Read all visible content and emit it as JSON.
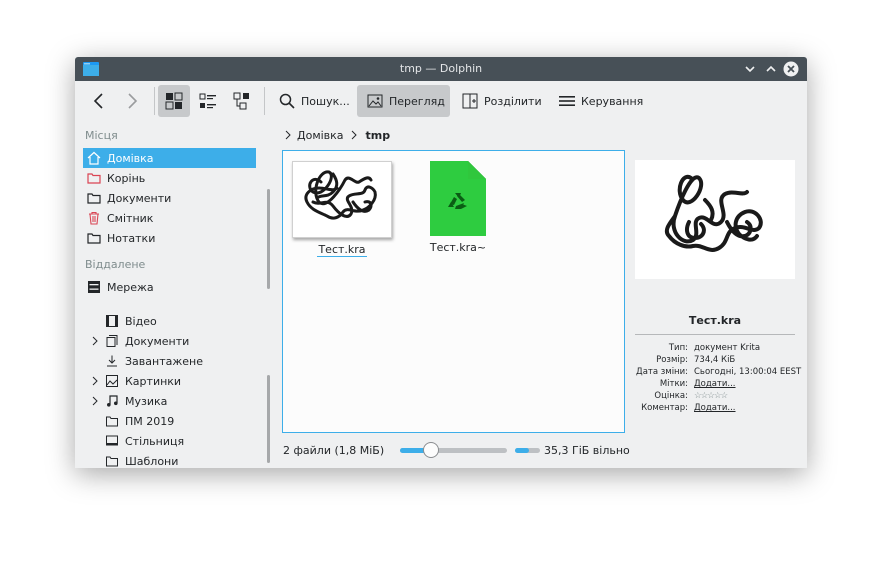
{
  "window": {
    "title": "tmp — Dolphin"
  },
  "toolbar": {
    "search_label": "Пошук...",
    "preview_label": "Перегляд",
    "split_label": "Розділити",
    "control_label": "Керування"
  },
  "sidebar": {
    "places_title": "Місця",
    "places": [
      {
        "label": "Домівка",
        "icon": "home-icon",
        "selected": true
      },
      {
        "label": "Корінь",
        "icon": "folder-red-icon"
      },
      {
        "label": "Документи",
        "icon": "folder-icon"
      },
      {
        "label": "Смітник",
        "icon": "trash-icon"
      },
      {
        "label": "Нотатки",
        "icon": "folder-icon"
      }
    ],
    "remote_title": "Віддалене",
    "remote": [
      {
        "label": "Мережа",
        "icon": "network-icon"
      }
    ],
    "tree": [
      {
        "label": "Відео",
        "icon": "video-icon",
        "expandable": false
      },
      {
        "label": "Документи",
        "icon": "documents-icon",
        "expandable": true
      },
      {
        "label": "Завантажене",
        "icon": "download-icon",
        "expandable": false
      },
      {
        "label": "Картинки",
        "icon": "pictures-icon",
        "expandable": true
      },
      {
        "label": "Музика",
        "icon": "music-icon",
        "expandable": true
      },
      {
        "label": "ПМ 2019",
        "icon": "folder-icon",
        "expandable": false
      },
      {
        "label": "Стільниця",
        "icon": "desktop-icon",
        "expandable": false
      },
      {
        "label": "Шаблони",
        "icon": "folder-icon",
        "expandable": false
      }
    ]
  },
  "breadcrumb": {
    "home": "Домівка",
    "current": "tmp"
  },
  "files": [
    {
      "name": "Тест.kra",
      "type": "kra-thumbnail"
    },
    {
      "name": "Тест.kra~",
      "type": "backup-file-icon"
    }
  ],
  "status": {
    "file_count": "2 файли (1,8 МіБ)",
    "zoom_percent": 25,
    "disk_used_percent": 55,
    "free_space": "35,3 ГіБ вільно"
  },
  "info_panel": {
    "filename": "Тест.kra",
    "rows": [
      {
        "key": "Тип:",
        "value": "документ Krita"
      },
      {
        "key": "Розмір:",
        "value": "734,4 КіБ"
      },
      {
        "key": "Дата зміни:",
        "value": "Сьогодні, 13:00:04 EEST"
      },
      {
        "key": "Мітки:",
        "value": "Додати..."
      },
      {
        "key": "Оцінка:",
        "value": "☆☆☆☆☆"
      },
      {
        "key": "Коментар:",
        "value": "Додати..."
      }
    ]
  },
  "colors": {
    "accent": "#3daee9",
    "titlebar": "#475057",
    "window_bg": "#eff0f1"
  }
}
